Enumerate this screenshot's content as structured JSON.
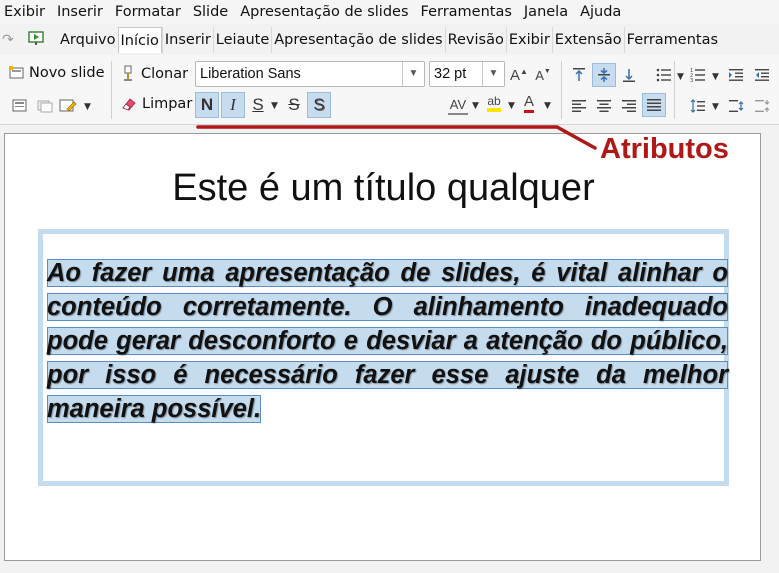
{
  "menubar": {
    "items": [
      "Exibir",
      "Inserir",
      "Formatar",
      "Slide",
      "Apresentação de slides",
      "Ferramentas",
      "Janela",
      "Ajuda"
    ]
  },
  "tabbar": {
    "tabs": [
      "Arquivo",
      "Início",
      "Inserir",
      "Leiaute",
      "Apresentação de slides",
      "Revisão",
      "Exibir",
      "Extensão",
      "Ferramentas"
    ],
    "active_tab": "Início"
  },
  "toolbar": {
    "new_slide_label": "Novo slide",
    "clone_label": "Clonar",
    "clear_label": "Limpar",
    "font_name": "Liberation Sans",
    "font_size": "32 pt",
    "bold_glyph": "N",
    "italic_glyph": "I",
    "underline_glyph": "S",
    "strike_glyph": "S",
    "shadow_glyph": "S",
    "char_spacing_glyph": "AV",
    "highlight_glyph": "ab",
    "font_color_glyph": "A",
    "grow_glyph": "A",
    "shrink_glyph": "A"
  },
  "slide": {
    "title": "Este é um título qualquer",
    "body_text": "Ao fazer uma apresentação de slides, é vital alinhar o conteúdo corretamente. O alinhamento inadequado pode gerar desconforto e desviar a atenção do público, por isso é necessário fazer esse ajuste da melhor maneira possível."
  },
  "annotation": {
    "label": "Atributos",
    "color": "#b01818"
  },
  "colors": {
    "selection": "#c5dcef",
    "toggle_active": "#c8dcf0",
    "highlight_yellow": "#ffe400",
    "font_color_red": "#d01010"
  }
}
